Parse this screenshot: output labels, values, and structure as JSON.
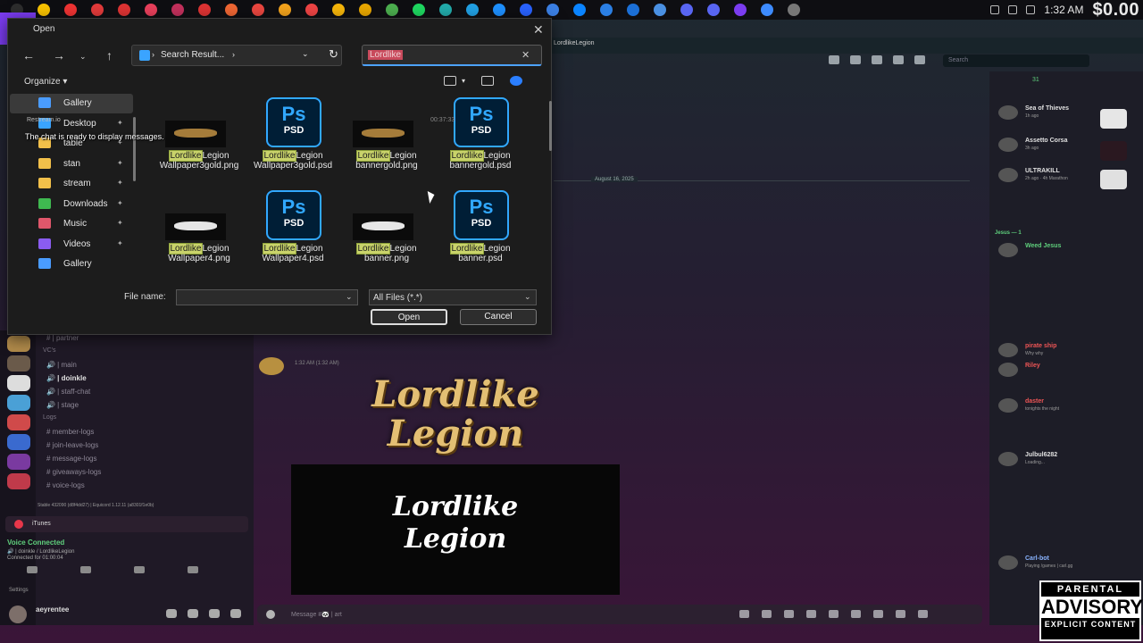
{
  "taskbar": {
    "time": "1:32 AM",
    "money": "$0.00",
    "icon_colors": [
      "#2d2d2d",
      "#f7c200",
      "#e33",
      "#e23a3a",
      "#d33",
      "#e83f5b",
      "#c2305c",
      "#d33",
      "#e63",
      "#e9463f",
      "#f2a21c",
      "#e44",
      "#f5b50a",
      "#e8a600",
      "#4cae4f",
      "#1ed760",
      "#2aa",
      "#21a0e4",
      "#1e90ff",
      "#2962ff",
      "#3b7fe3",
      "#0a84ff",
      "#2b7fe3",
      "#1b6fd6",
      "#4a90e2",
      "#5865f2",
      "#5865f2",
      "#7b3cf0",
      "#3d8bff",
      "#777"
    ]
  },
  "overlay": {
    "stream_number": "1",
    "chat_ready": "The chat is ready to display messages.",
    "restream": "Restream.io",
    "timestamp": "00:37:33"
  },
  "dialog": {
    "title": "Open",
    "address": "Search Result...",
    "search_value": "Lordlike",
    "organize": "Organize",
    "sidebar": [
      {
        "label": "Gallery",
        "icon": "gallery-icon",
        "color": "#4a9cff",
        "pinned": false,
        "selected": true
      },
      {
        "label": "Desktop",
        "icon": "desktop-icon",
        "color": "#3aa4ff",
        "pinned": true,
        "selected": false
      },
      {
        "label": "table",
        "icon": "folder-icon",
        "color": "#f2c04a",
        "pinned": true,
        "selected": false
      },
      {
        "label": "stan",
        "icon": "folder-icon",
        "color": "#f2c04a",
        "pinned": true,
        "selected": false
      },
      {
        "label": "stream",
        "icon": "folder-icon",
        "color": "#f2c04a",
        "pinned": true,
        "selected": false
      },
      {
        "label": "Downloads",
        "icon": "download-icon",
        "color": "#3fb950",
        "pinned": true,
        "selected": false
      },
      {
        "label": "Music",
        "icon": "music-icon",
        "color": "#e0576b",
        "pinned": true,
        "selected": false
      },
      {
        "label": "Videos",
        "icon": "videos-icon",
        "color": "#8a5cf0",
        "pinned": true,
        "selected": false
      },
      {
        "label": "Gallery",
        "icon": "gallery-icon",
        "color": "#4a9cff",
        "pinned": false,
        "selected": false
      }
    ],
    "files": [
      {
        "highlight": "Lordlike",
        "rest": "Legion Wallpaper3gold.png",
        "kind": "png-gold"
      },
      {
        "highlight": "Lordlike",
        "rest": "Legion Wallpaper3gold.psd",
        "kind": "psd"
      },
      {
        "highlight": "Lordlike",
        "rest": "Legion bannergold.png",
        "kind": "png-gold"
      },
      {
        "highlight": "Lordlike",
        "rest": "Legion bannergold.psd",
        "kind": "psd"
      },
      {
        "highlight": "Lordlike",
        "rest": "Legion Wallpaper4.png",
        "kind": "png-white"
      },
      {
        "highlight": "Lordlike",
        "rest": "Legion Wallpaper4.psd",
        "kind": "psd"
      },
      {
        "highlight": "Lordlike",
        "rest": "Legion banner.png",
        "kind": "png-white"
      },
      {
        "highlight": "Lordlike",
        "rest": "Legion banner.psd",
        "kind": "psd"
      }
    ],
    "ps_label": "Ps",
    "psd_label": "PSD",
    "file_name_label": "File name:",
    "file_name_value": "",
    "file_type": "All Files (*.*)",
    "open_label": "Open",
    "cancel_label": "Cancel"
  },
  "discord": {
    "server_title": "LordlikeLegion",
    "search_placeholder": "Search",
    "member_count": "31",
    "date_divider": "August 16, 2025",
    "msg_time": "1:32 AM (1:32 AM)",
    "logo_gold_line1": "Lordlike",
    "logo_gold_line2": "Legion",
    "logo_white_line1": "Lordlike",
    "logo_white_line2": "Legion",
    "message_placeholder": "Message #🐼 | art",
    "channels": [
      {
        "label": "# | partner",
        "head": false
      },
      {
        "label": "VC's",
        "head": true
      },
      {
        "label": "🔊 | main",
        "head": false
      },
      {
        "label": "🔊 | doinkle",
        "head": false,
        "user": true
      },
      {
        "label": "🔊 | staff-chat",
        "head": false
      },
      {
        "label": "🔊 | stage",
        "head": false
      },
      {
        "label": "Logs",
        "head": true
      },
      {
        "label": "# member-logs",
        "head": false
      },
      {
        "label": "# join-leave-logs",
        "head": false
      },
      {
        "label": "# message-logs",
        "head": false
      },
      {
        "label": "# giveaways-logs",
        "head": false
      },
      {
        "label": "# voice-logs",
        "head": false
      }
    ],
    "status_line": "Stable 432090 (d8f4dd27) | Equicord 1.12.11 (a8301f1e0b)",
    "itunes": "iTunes",
    "voice_connected": "Voice Connected",
    "voice_channel": "🔊 | doinkle / LordlikeLegion",
    "voice_duration": "Connected for 01:00:04",
    "settings": "Settings",
    "username": "aeyrentee",
    "members": [
      {
        "name": "Sea of Thieves",
        "sub": "1h ago",
        "color": "#e0e0e0"
      },
      {
        "name": "Assetto Corsa",
        "sub": "3h ago",
        "color": "#e0e0e0"
      },
      {
        "name": "ULTRAKILL",
        "sub": "2h ago · 4h Marathon",
        "color": "#e0e0e0"
      },
      {
        "name": "Jesus — 1",
        "sub": "",
        "color": "#5fcf7c",
        "head": true
      },
      {
        "name": "Weed Jesus",
        "sub": "",
        "color": "#5fcf7c"
      },
      {
        "name": "pirate ship",
        "sub": "Why why",
        "color": "#e55"
      },
      {
        "name": "Riley",
        "sub": "",
        "color": "#e55"
      },
      {
        "name": "daster",
        "sub": "tonights the night",
        "color": "#e55"
      },
      {
        "name": "Julbul6282",
        "sub": "Loading...",
        "color": "#e0e0e0"
      },
      {
        "name": "Carl-bot",
        "sub": "Playing /games | carl.gg",
        "color": "#8ab4ff"
      }
    ]
  },
  "advisory": {
    "top": "PARENTAL",
    "mid": "ADVISORY",
    "bottom": "EXPLICIT CONTENT"
  }
}
